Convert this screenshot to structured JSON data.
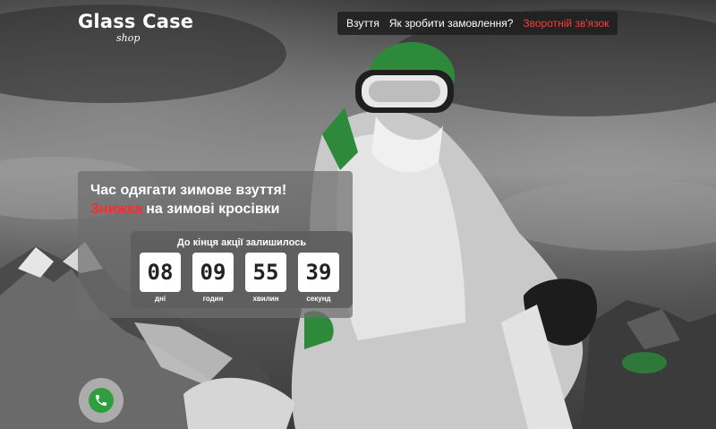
{
  "logo": {
    "title": "Glass Case",
    "subtitle": "shop"
  },
  "nav": {
    "items": [
      {
        "label": "Взуття"
      },
      {
        "label": "Як зробити замовлення?"
      },
      {
        "label": "Зворотній зв'язок"
      }
    ]
  },
  "promo": {
    "headline": "Час одягати зимове взуття!",
    "discount_word": "Знижка",
    "discount_rest": " на зимові кросівки",
    "countdown": {
      "title": "До кінця акції залишилось",
      "units": [
        {
          "value": "08",
          "label": "дні"
        },
        {
          "value": "09",
          "label": "годин"
        },
        {
          "value": "55",
          "label": "хвилин"
        },
        {
          "value": "39",
          "label": "секунд"
        }
      ]
    }
  },
  "colors": {
    "accent": "#ff3b3b",
    "panel": "#6e6e6e",
    "phone": "#2e9e3e"
  },
  "icons": {
    "phone": "phone-icon"
  }
}
